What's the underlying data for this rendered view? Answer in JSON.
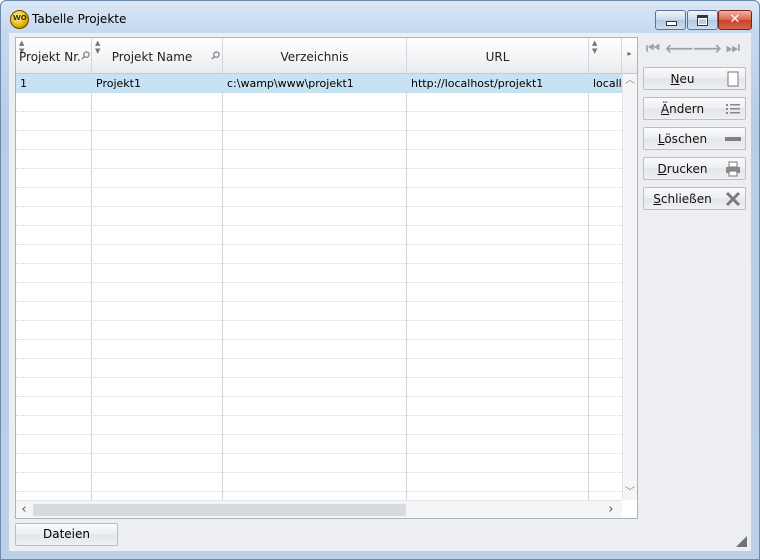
{
  "window": {
    "title": "Tabelle Projekte",
    "app_icon_text": "WO"
  },
  "grid": {
    "columns": [
      "Projekt Nr.",
      "Projekt Name",
      "Verzeichnis",
      "URL",
      ""
    ],
    "rows": [
      [
        "1",
        "Projekt1",
        "c:\\wamp\\www\\projekt1",
        "http://localhost/projekt1",
        "locall"
      ]
    ]
  },
  "nav": {
    "first": "⏮",
    "prev": "⟵",
    "next": "⟶",
    "last": "⏭"
  },
  "buttons": {
    "neu": {
      "mnemonic": "N",
      "rest": "eu"
    },
    "aendern": {
      "mnemonic": "Ä",
      "rest": "ndern"
    },
    "loeschen": {
      "mnemonic": "L",
      "rest": "öschen"
    },
    "drucken": {
      "mnemonic": "D",
      "rest": "rucken"
    },
    "schliessen": {
      "mnemonic": "S",
      "rest": "chließen"
    }
  },
  "footer": {
    "dateien_label": "Dateien"
  }
}
